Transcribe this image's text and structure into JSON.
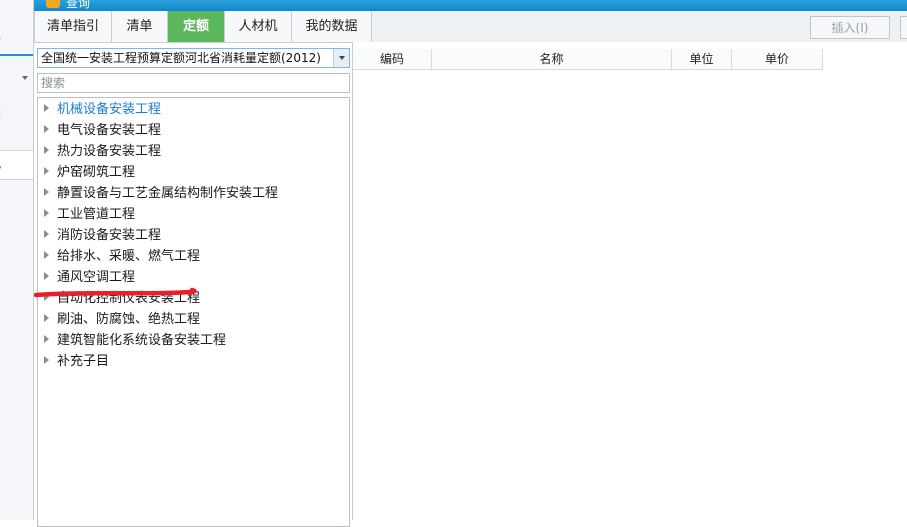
{
  "window": {
    "title": "查询"
  },
  "left_panel": {
    "pricing_label": "价",
    "doc_label": "档",
    "delete_label": "除",
    "status_label": "况"
  },
  "tabs": [
    {
      "label": "清单指引",
      "active": false
    },
    {
      "label": "清单",
      "active": false
    },
    {
      "label": "定额",
      "active": true
    },
    {
      "label": "人材机",
      "active": false
    },
    {
      "label": "我的数据",
      "active": false
    }
  ],
  "toolbar": {
    "insert_label": "插入(I)"
  },
  "quota_library": {
    "selected": "全国统一安装工程预算定额河北省消耗量定额(2012)"
  },
  "search": {
    "placeholder": "搜索"
  },
  "tree": {
    "items": [
      {
        "label": "机械设备安装工程",
        "selected": true
      },
      {
        "label": "电气设备安装工程"
      },
      {
        "label": "热力设备安装工程"
      },
      {
        "label": "炉窑砌筑工程"
      },
      {
        "label": "静置设备与工艺金属结构制作安装工程"
      },
      {
        "label": "工业管道工程"
      },
      {
        "label": "消防设备安装工程"
      },
      {
        "label": "给排水、采暖、燃气工程"
      },
      {
        "label": "通风空调工程"
      },
      {
        "label": "自动化控制仪表安装工程"
      },
      {
        "label": "刷油、防腐蚀、绝热工程"
      },
      {
        "label": "建筑智能化系统设备安装工程"
      },
      {
        "label": "补充子目"
      }
    ]
  },
  "grid": {
    "columns": [
      "编码",
      "名称",
      "单位",
      "单价"
    ]
  },
  "colors": {
    "accent": "#1387cf",
    "active_tab": "#5cb85c",
    "selected_text": "#1b7fd0",
    "annotation": "#e8202a"
  }
}
